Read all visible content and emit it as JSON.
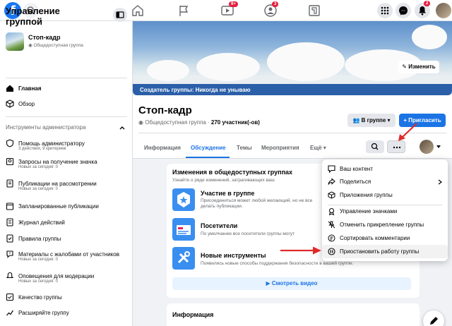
{
  "topbar": {
    "logo": "f",
    "badges": {
      "watch": "9+",
      "groups": "3",
      "notifications": "2"
    }
  },
  "sidebar": {
    "title": "Управление группой",
    "group_name": "Стоп-кадр",
    "group_privacy": "Общедоступная группа",
    "items": [
      {
        "label": "Главная"
      },
      {
        "label": "Обзор"
      }
    ],
    "section_title": "Инструменты администратора",
    "tools": [
      {
        "label": "Помощь администратору",
        "sub": "3 действия, 9 критериев"
      },
      {
        "label": "Запросы на получение значка",
        "sub": "Новых за сегодня: 0"
      },
      {
        "label": "Публикации на рассмотрении",
        "sub": "Новых за сегодня: 0"
      },
      {
        "label": "Запланированные публикации",
        "sub": ""
      },
      {
        "label": "Журнал действий",
        "sub": ""
      },
      {
        "label": "Правила группы",
        "sub": ""
      },
      {
        "label": "Материалы с жалобами от участников",
        "sub": "Новых за сегодня: 0"
      },
      {
        "label": "Оповещения для модерации",
        "sub": "Новых за сегодня: 0"
      },
      {
        "label": "Качество группы",
        "sub": ""
      },
      {
        "label": "Расширяйте группу",
        "sub": ""
      }
    ]
  },
  "cover": {
    "caption": "Создатель группы: Никогда не унываю",
    "edit_label": "Изменить"
  },
  "group": {
    "title": "Стоп-кадр",
    "privacy": "Общедоступная группа",
    "members": "270 участник(-ов)",
    "in_group_label": "В группе",
    "invite_label": "+ Пригласить"
  },
  "tabs": [
    "Информация",
    "Обсуждение",
    "Темы",
    "Мероприятия",
    "Ещё"
  ],
  "changes_card": {
    "title": "Изменения в общедоступных группах",
    "subtitle": "Узнайте о ряде изменений, затрагивающих ваш",
    "features": [
      {
        "title": "Участие в группе",
        "desc": "Присоединиться может любой желающий, но не все",
        "desc2": "делать публикации."
      },
      {
        "title": "Посетители",
        "desc": "По умолчанию все посетители группы могут",
        "desc2": ""
      },
      {
        "title": "Новые инструменты",
        "desc": "Появились новые способы поддержания безопасности в вашей группе.",
        "desc2": ""
      }
    ],
    "video_label": "Смотреть видео"
  },
  "info_card": {
    "title": "Информация"
  },
  "menu": {
    "items": [
      {
        "label": "Ваш контент",
        "icon": "comment-icon"
      },
      {
        "label": "Поделиться",
        "icon": "share-icon"
      },
      {
        "label": "Приложения группы",
        "icon": "cube-icon"
      },
      {
        "label": "Управление значками",
        "icon": "badge-icon"
      },
      {
        "label": "Отменить прикрепление группы",
        "icon": "unpin-icon"
      },
      {
        "label": "Сортировать комментарии",
        "icon": "sort-icon"
      },
      {
        "label": "Приостановить работу группы",
        "icon": "pause-icon"
      }
    ]
  },
  "colors": {
    "accent": "#1b74e4",
    "arrow": "#e02a2a"
  }
}
